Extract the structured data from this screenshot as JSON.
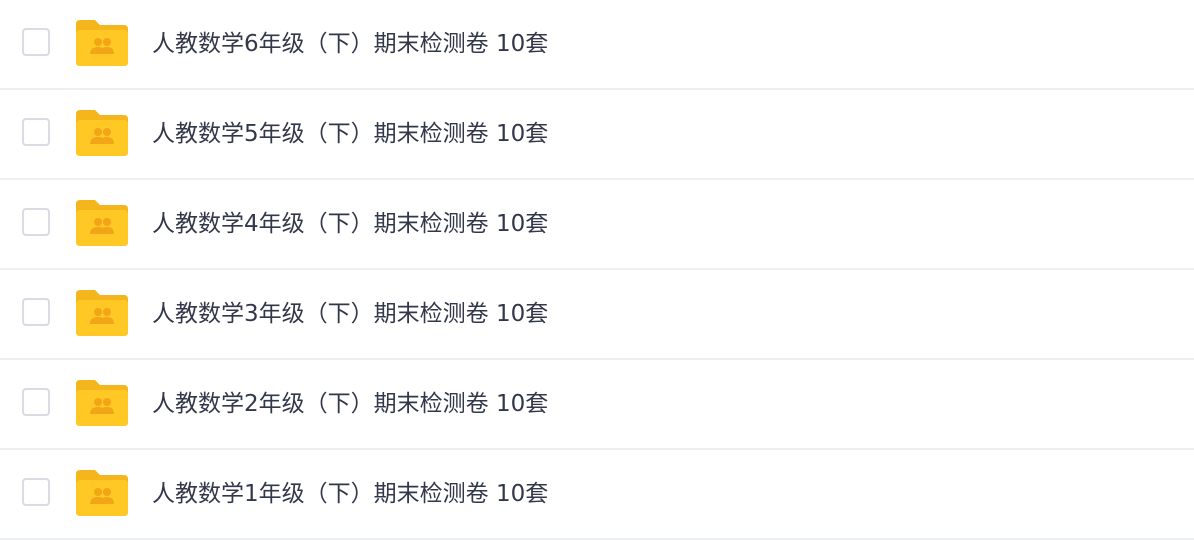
{
  "file_list": {
    "items": [
      {
        "name": "人教数学6年级（下）期末检测卷 10套",
        "icon": "shared-folder-icon"
      },
      {
        "name": "人教数学5年级（下）期末检测卷 10套",
        "icon": "shared-folder-icon"
      },
      {
        "name": "人教数学4年级（下）期末检测卷 10套",
        "icon": "shared-folder-icon"
      },
      {
        "name": "人教数学3年级（下）期末检测卷 10套",
        "icon": "shared-folder-icon"
      },
      {
        "name": "人教数学2年级（下）期末检测卷 10套",
        "icon": "shared-folder-icon"
      },
      {
        "name": "人教数学1年级（下）期末检测卷 10套",
        "icon": "shared-folder-icon"
      }
    ]
  },
  "colors": {
    "folder": "#ffc824",
    "folder_tab": "#f5b51d",
    "folder_people": "#f2a516",
    "text": "#33374a",
    "divider": "#eef0f4",
    "checkbox_border": "#d9dce3"
  }
}
